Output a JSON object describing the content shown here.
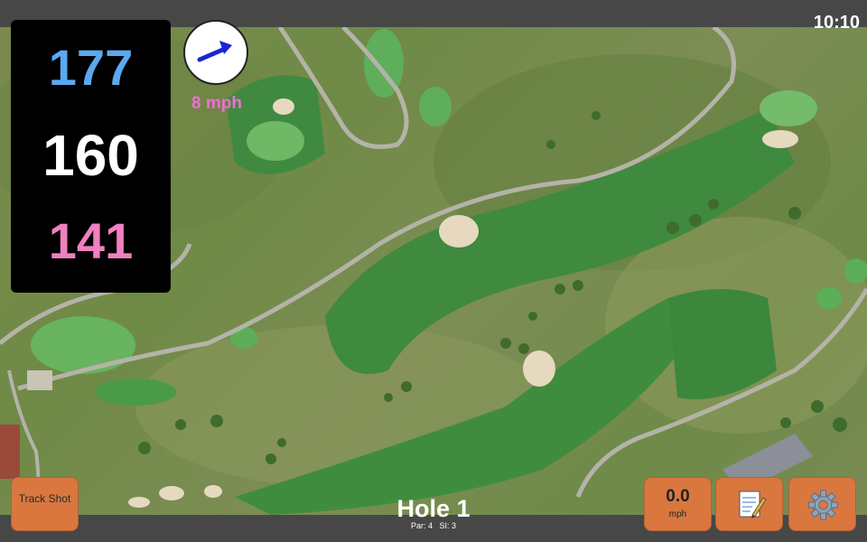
{
  "status": {
    "clock": "10:10"
  },
  "distances": {
    "back": "177",
    "middle": "160",
    "front": "141"
  },
  "wind": {
    "speed": "8 mph",
    "icon": "wind-arrow-icon"
  },
  "buttons": {
    "track_shot": "Track Shot",
    "speed_value": "0.0",
    "speed_unit": "mph",
    "notes_icon": "notepad-icon",
    "settings_icon": "gear-icon"
  },
  "hole": {
    "title": "Hole 1",
    "par": "Par: 4",
    "si": "SI: 3"
  },
  "colors": {
    "back": "#5aa9f0",
    "middle": "#ffffff",
    "front": "#f080c0",
    "button": "#d9773f",
    "wind_text": "#f070d0"
  }
}
